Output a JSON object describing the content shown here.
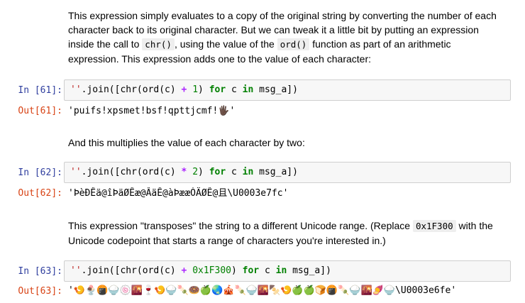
{
  "para1": {
    "line1": "This expression simply evaluates to a copy of the original string by converting the number of each",
    "line2": "character back to its original character. But we can tweak it a little bit by putting an expression",
    "line3_a": "inside the call to ",
    "line3_code1": "chr()",
    "line3_b": ", using the value of the ",
    "line3_code2": "ord()",
    "line3_c": " function as part of an arithmetic",
    "line4": "expression. This expression adds one to the value of each character:"
  },
  "cell61": {
    "in_prompt": "In [61]:",
    "out_prompt": "Out[61]:",
    "code": {
      "t1": "''",
      "t2": ".join([chr(ord(c) ",
      "t3": "+",
      "t4": " ",
      "t5": "1",
      "t6": ") ",
      "t7": "for",
      "t8": " c ",
      "t9": "in",
      "t10": " msg_a])"
    },
    "output": "'puifs!xpsmet!bsf!qpttjcmf!🖐🏿'"
  },
  "para2": {
    "text": "And this multiplies the value of each character by two:"
  },
  "cell62": {
    "in_prompt": "In [62]:",
    "out_prompt": "Out[62]:",
    "code": {
      "t1": "''",
      "t2": ".join([chr(ord(c) ",
      "t3": "*",
      "t4": " ",
      "t5": "2",
      "t6": ") ",
      "t7": "for",
      "t8": " c ",
      "t9": "in",
      "t10": " msg_a])"
    },
    "output": "'ÞèÐÊä@îÞäØÊæ@ÂäÊ@àÞææÒÄØÊ@且\\U0003e7fc'"
  },
  "para3": {
    "line1_a": "This expression \"transposes\" the string to a different Unicode range. (Replace ",
    "line1_code": "0x1F300",
    "line1_b": " with the",
    "line2": "Unicode codepoint that starts a range of characters you're interested in.)"
  },
  "cell63": {
    "in_prompt": "In [63]:",
    "out_prompt": "Out[63]:",
    "code": {
      "t1": "''",
      "t2": ".join([chr(ord(c) ",
      "t3": "+",
      "t4": " ",
      "t5": "0x1F300",
      "t6": ") ",
      "t7": "for",
      "t8": " c ",
      "t9": "in",
      "t10": " msg_a])"
    },
    "output": "'🍤🍨🍘🍚🍥🌇🍷🍤🍚🍡🍩🍏🌏🎪🍡🍚🌇🍢🍤🍏🍏🍞🍘🍡🍚🌇🍠🍚\\U0003e6fe'"
  }
}
